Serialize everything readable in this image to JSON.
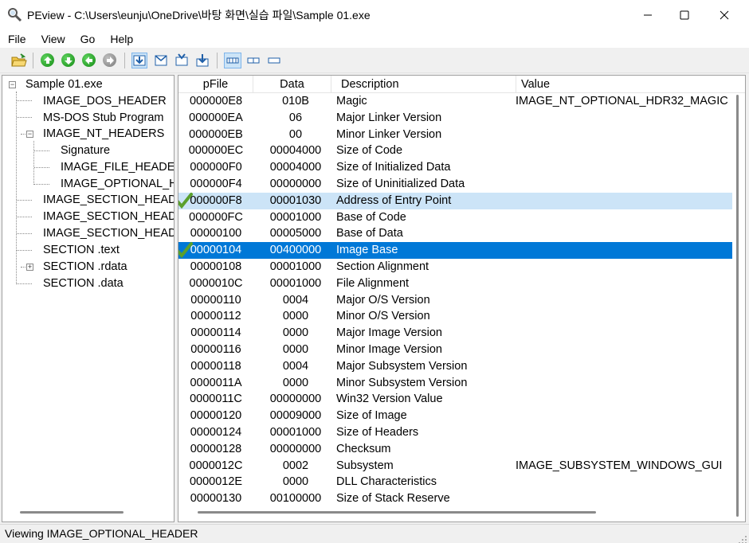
{
  "window": {
    "title": "PEview - C:\\Users\\eunju\\OneDrive\\바탕 화면\\실습 파일\\Sample 01.exe",
    "minimize_icon": "minimize-icon",
    "maximize_icon": "maximize-icon",
    "close_icon": "close-icon"
  },
  "menu": {
    "items": [
      "File",
      "View",
      "Go",
      "Help"
    ]
  },
  "toolbar": {
    "icons": [
      "open-file-icon",
      "go-up-icon",
      "go-down-icon",
      "go-back-icon",
      "go-forward-icon",
      "view-hex-icon",
      "view-mail-icon",
      "view-import-icon",
      "view-export-icon",
      "view-details-icon",
      "view-list-icon",
      "view-small-icon"
    ]
  },
  "tree": {
    "items": [
      "Sample 01.exe",
      "IMAGE_DOS_HEADER",
      "MS-DOS Stub Program",
      "IMAGE_NT_HEADERS",
      "Signature",
      "IMAGE_FILE_HEADER",
      "IMAGE_OPTIONAL_HEADER",
      "IMAGE_SECTION_HEADER .text",
      "IMAGE_SECTION_HEADER .rdata",
      "IMAGE_SECTION_HEADER .data",
      "SECTION .text",
      "SECTION .rdata",
      "SECTION .data"
    ]
  },
  "list": {
    "columns": [
      "pFile",
      "Data",
      "Description",
      "Value"
    ],
    "rows": [
      [
        "000000E8",
        "010B",
        "Magic",
        "IMAGE_NT_OPTIONAL_HDR32_MAGIC"
      ],
      [
        "000000EA",
        "06",
        "Major Linker Version",
        ""
      ],
      [
        "000000EB",
        "00",
        "Minor Linker Version",
        ""
      ],
      [
        "000000EC",
        "00004000",
        "Size of Code",
        ""
      ],
      [
        "000000F0",
        "00004000",
        "Size of Initialized Data",
        ""
      ],
      [
        "000000F4",
        "00000000",
        "Size of Uninitialized Data",
        ""
      ],
      [
        "000000F8",
        "00001030",
        "Address of Entry Point",
        ""
      ],
      [
        "000000FC",
        "00001000",
        "Base of Code",
        ""
      ],
      [
        "00000100",
        "00005000",
        "Base of Data",
        ""
      ],
      [
        "00000104",
        "00400000",
        "Image Base",
        ""
      ],
      [
        "00000108",
        "00001000",
        "Section Alignment",
        ""
      ],
      [
        "0000010C",
        "00001000",
        "File Alignment",
        ""
      ],
      [
        "00000110",
        "0004",
        "Major O/S Version",
        ""
      ],
      [
        "00000112",
        "0000",
        "Minor O/S Version",
        ""
      ],
      [
        "00000114",
        "0000",
        "Major Image Version",
        ""
      ],
      [
        "00000116",
        "0000",
        "Minor Image Version",
        ""
      ],
      [
        "00000118",
        "0004",
        "Major Subsystem Version",
        ""
      ],
      [
        "0000011A",
        "0000",
        "Minor Subsystem Version",
        ""
      ],
      [
        "0000011C",
        "00000000",
        "Win32 Version Value",
        ""
      ],
      [
        "00000120",
        "00009000",
        "Size of Image",
        ""
      ],
      [
        "00000124",
        "00001000",
        "Size of Headers",
        ""
      ],
      [
        "00000128",
        "00000000",
        "Checksum",
        ""
      ],
      [
        "0000012C",
        "0002",
        "Subsystem",
        "IMAGE_SUBSYSTEM_WINDOWS_GUI"
      ],
      [
        "0000012E",
        "0000",
        "DLL Characteristics",
        ""
      ],
      [
        "00000130",
        "00100000",
        "Size of Stack Reserve",
        ""
      ]
    ],
    "selected_row": 9,
    "highlighted_row": 6
  },
  "status": {
    "text": "Viewing IMAGE_OPTIONAL_HEADER"
  },
  "colors": {
    "selection": "#0078d7",
    "highlight": "#cce4f7",
    "checkmark": "#5aa02c"
  }
}
